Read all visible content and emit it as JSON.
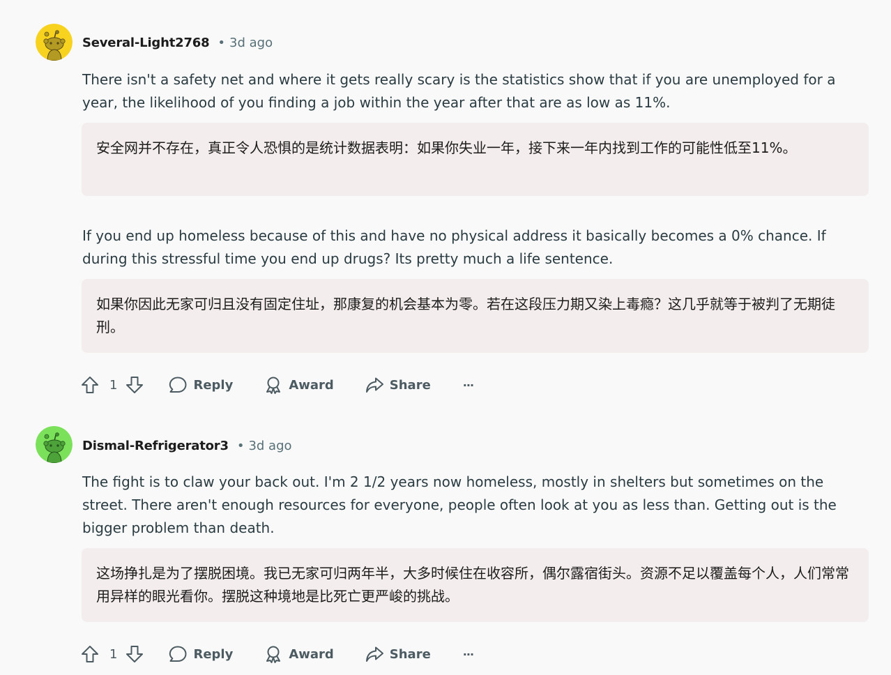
{
  "comments": [
    {
      "username": "Several-Light2768",
      "separator": "•",
      "time": "3d ago",
      "avatar_color": "#f7d21f",
      "paragraphs": [
        {
          "text": "There isn't a safety net and where it gets really scary is the statistics show that if you are unemployed for a year, the likelihood of you finding a job within the year after that are as low as 11%.",
          "translation": "安全网并不存在，真正令人恐惧的是统计数据表明：如果你失业一年，接下来一年内找到工作的可能性低至11%。"
        },
        {
          "text": "If you end up homeless because of this and have no physical address it basically becomes a 0% chance. If during this stressful time you end up drugs? Its pretty much a life sentence.",
          "translation": "如果你因此无家可归且没有固定住址，那康复的机会基本为零。若在这段压力期又染上毒瘾？这几乎就等于被判了无期徒刑。"
        }
      ],
      "votes": "1",
      "actions": {
        "reply": "Reply",
        "award": "Award",
        "share": "Share",
        "more": "···"
      }
    },
    {
      "username": "Dismal-Refrigerator3",
      "separator": "•",
      "time": "3d ago",
      "avatar_color": "#7be15a",
      "paragraphs": [
        {
          "text": "The fight is to claw your back out. I'm 2 1/2 years now homeless, mostly in shelters but sometimes on the street. There aren't enough resources for everyone, people often look at you as less than. Getting out is the bigger problem than death.",
          "translation": "这场挣扎是为了摆脱困境。我已无家可归两年半，大多时候住在收容所，偶尔露宿街头。资源不足以覆盖每个人，人们常常用异样的眼光看你。摆脱这种境地是比死亡更严峻的挑战。"
        }
      ],
      "votes": "1",
      "actions": {
        "reply": "Reply",
        "award": "Award",
        "share": "Share",
        "more": "···"
      }
    }
  ],
  "icons": {
    "upvote": "arrow-up-icon",
    "downvote": "arrow-down-icon",
    "reply": "speech-bubble-icon",
    "award": "ribbon-award-icon",
    "share": "share-arrow-icon",
    "more": "ellipsis-icon",
    "avatar": "snoo-avatar-icon"
  }
}
